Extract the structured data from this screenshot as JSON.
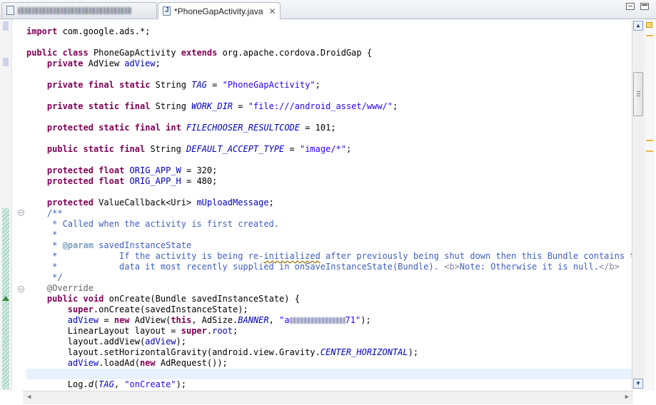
{
  "tabs": [
    {
      "label": "",
      "active": false
    },
    {
      "label": "*PhoneGapActivity.java",
      "active": true,
      "close": "✕"
    }
  ],
  "icons": {
    "file": "java-file-icon",
    "close": "close-icon",
    "minimize": "minimize-icon",
    "maximize": "maximize-icon",
    "fold": "fold-collapse-icon",
    "override": "override-triangle-icon"
  },
  "code": {
    "redacted_value_suffix": ".71\")"
  },
  "scrollbar": {
    "up": "▲",
    "down": "▼",
    "left": "◀",
    "right": "▶"
  },
  "colors": {
    "keyword": "#7f0055",
    "string": "#2a00ff",
    "field": "#0000c0",
    "comment": "#3f5fbf",
    "current_line": "#e8f2fe"
  }
}
